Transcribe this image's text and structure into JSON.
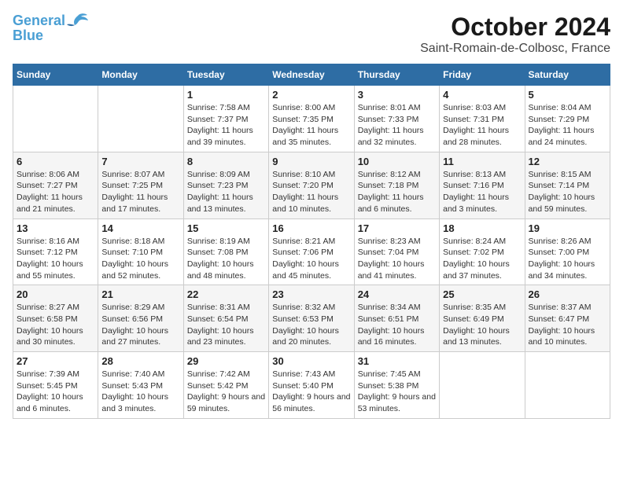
{
  "header": {
    "logo_line1": "General",
    "logo_line2": "Blue",
    "month": "October 2024",
    "location": "Saint-Romain-de-Colbosc, France"
  },
  "weekdays": [
    "Sunday",
    "Monday",
    "Tuesday",
    "Wednesday",
    "Thursday",
    "Friday",
    "Saturday"
  ],
  "weeks": [
    [
      {
        "day": null
      },
      {
        "day": null
      },
      {
        "day": 1,
        "sunrise": "Sunrise: 7:58 AM",
        "sunset": "Sunset: 7:37 PM",
        "daylight": "Daylight: 11 hours and 39 minutes."
      },
      {
        "day": 2,
        "sunrise": "Sunrise: 8:00 AM",
        "sunset": "Sunset: 7:35 PM",
        "daylight": "Daylight: 11 hours and 35 minutes."
      },
      {
        "day": 3,
        "sunrise": "Sunrise: 8:01 AM",
        "sunset": "Sunset: 7:33 PM",
        "daylight": "Daylight: 11 hours and 32 minutes."
      },
      {
        "day": 4,
        "sunrise": "Sunrise: 8:03 AM",
        "sunset": "Sunset: 7:31 PM",
        "daylight": "Daylight: 11 hours and 28 minutes."
      },
      {
        "day": 5,
        "sunrise": "Sunrise: 8:04 AM",
        "sunset": "Sunset: 7:29 PM",
        "daylight": "Daylight: 11 hours and 24 minutes."
      }
    ],
    [
      {
        "day": 6,
        "sunrise": "Sunrise: 8:06 AM",
        "sunset": "Sunset: 7:27 PM",
        "daylight": "Daylight: 11 hours and 21 minutes."
      },
      {
        "day": 7,
        "sunrise": "Sunrise: 8:07 AM",
        "sunset": "Sunset: 7:25 PM",
        "daylight": "Daylight: 11 hours and 17 minutes."
      },
      {
        "day": 8,
        "sunrise": "Sunrise: 8:09 AM",
        "sunset": "Sunset: 7:23 PM",
        "daylight": "Daylight: 11 hours and 13 minutes."
      },
      {
        "day": 9,
        "sunrise": "Sunrise: 8:10 AM",
        "sunset": "Sunset: 7:20 PM",
        "daylight": "Daylight: 11 hours and 10 minutes."
      },
      {
        "day": 10,
        "sunrise": "Sunrise: 8:12 AM",
        "sunset": "Sunset: 7:18 PM",
        "daylight": "Daylight: 11 hours and 6 minutes."
      },
      {
        "day": 11,
        "sunrise": "Sunrise: 8:13 AM",
        "sunset": "Sunset: 7:16 PM",
        "daylight": "Daylight: 11 hours and 3 minutes."
      },
      {
        "day": 12,
        "sunrise": "Sunrise: 8:15 AM",
        "sunset": "Sunset: 7:14 PM",
        "daylight": "Daylight: 10 hours and 59 minutes."
      }
    ],
    [
      {
        "day": 13,
        "sunrise": "Sunrise: 8:16 AM",
        "sunset": "Sunset: 7:12 PM",
        "daylight": "Daylight: 10 hours and 55 minutes."
      },
      {
        "day": 14,
        "sunrise": "Sunrise: 8:18 AM",
        "sunset": "Sunset: 7:10 PM",
        "daylight": "Daylight: 10 hours and 52 minutes."
      },
      {
        "day": 15,
        "sunrise": "Sunrise: 8:19 AM",
        "sunset": "Sunset: 7:08 PM",
        "daylight": "Daylight: 10 hours and 48 minutes."
      },
      {
        "day": 16,
        "sunrise": "Sunrise: 8:21 AM",
        "sunset": "Sunset: 7:06 PM",
        "daylight": "Daylight: 10 hours and 45 minutes."
      },
      {
        "day": 17,
        "sunrise": "Sunrise: 8:23 AM",
        "sunset": "Sunset: 7:04 PM",
        "daylight": "Daylight: 10 hours and 41 minutes."
      },
      {
        "day": 18,
        "sunrise": "Sunrise: 8:24 AM",
        "sunset": "Sunset: 7:02 PM",
        "daylight": "Daylight: 10 hours and 37 minutes."
      },
      {
        "day": 19,
        "sunrise": "Sunrise: 8:26 AM",
        "sunset": "Sunset: 7:00 PM",
        "daylight": "Daylight: 10 hours and 34 minutes."
      }
    ],
    [
      {
        "day": 20,
        "sunrise": "Sunrise: 8:27 AM",
        "sunset": "Sunset: 6:58 PM",
        "daylight": "Daylight: 10 hours and 30 minutes."
      },
      {
        "day": 21,
        "sunrise": "Sunrise: 8:29 AM",
        "sunset": "Sunset: 6:56 PM",
        "daylight": "Daylight: 10 hours and 27 minutes."
      },
      {
        "day": 22,
        "sunrise": "Sunrise: 8:31 AM",
        "sunset": "Sunset: 6:54 PM",
        "daylight": "Daylight: 10 hours and 23 minutes."
      },
      {
        "day": 23,
        "sunrise": "Sunrise: 8:32 AM",
        "sunset": "Sunset: 6:53 PM",
        "daylight": "Daylight: 10 hours and 20 minutes."
      },
      {
        "day": 24,
        "sunrise": "Sunrise: 8:34 AM",
        "sunset": "Sunset: 6:51 PM",
        "daylight": "Daylight: 10 hours and 16 minutes."
      },
      {
        "day": 25,
        "sunrise": "Sunrise: 8:35 AM",
        "sunset": "Sunset: 6:49 PM",
        "daylight": "Daylight: 10 hours and 13 minutes."
      },
      {
        "day": 26,
        "sunrise": "Sunrise: 8:37 AM",
        "sunset": "Sunset: 6:47 PM",
        "daylight": "Daylight: 10 hours and 10 minutes."
      }
    ],
    [
      {
        "day": 27,
        "sunrise": "Sunrise: 7:39 AM",
        "sunset": "Sunset: 5:45 PM",
        "daylight": "Daylight: 10 hours and 6 minutes."
      },
      {
        "day": 28,
        "sunrise": "Sunrise: 7:40 AM",
        "sunset": "Sunset: 5:43 PM",
        "daylight": "Daylight: 10 hours and 3 minutes."
      },
      {
        "day": 29,
        "sunrise": "Sunrise: 7:42 AM",
        "sunset": "Sunset: 5:42 PM",
        "daylight": "Daylight: 9 hours and 59 minutes."
      },
      {
        "day": 30,
        "sunrise": "Sunrise: 7:43 AM",
        "sunset": "Sunset: 5:40 PM",
        "daylight": "Daylight: 9 hours and 56 minutes."
      },
      {
        "day": 31,
        "sunrise": "Sunrise: 7:45 AM",
        "sunset": "Sunset: 5:38 PM",
        "daylight": "Daylight: 9 hours and 53 minutes."
      },
      {
        "day": null
      },
      {
        "day": null
      }
    ]
  ]
}
